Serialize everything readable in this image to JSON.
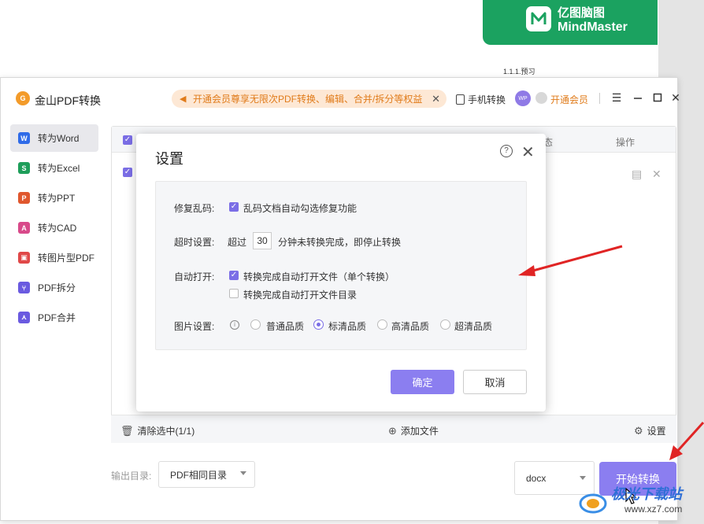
{
  "background": {
    "banner": {
      "brand_cn": "亿图脑图",
      "brand_en": "MindMaster"
    },
    "doc_text": "1.1.1.预习"
  },
  "app": {
    "title": "金山PDF转换",
    "promo_text": "开通会员尊享无限次PDF转换、编辑、合并/拆分等权益",
    "mobile_convert": "手机转换",
    "avatar_text": "WP",
    "vip_label": "开通会员",
    "accent": "#8b7ef0"
  },
  "sidebar": {
    "items": [
      {
        "label": "转为Word",
        "icon": "W",
        "color": "#2f6be8",
        "active": true
      },
      {
        "label": "转为Excel",
        "icon": "S",
        "color": "#1e9e5a",
        "active": false
      },
      {
        "label": "转为PPT",
        "icon": "P",
        "color": "#e0572e",
        "active": false
      },
      {
        "label": "转为CAD",
        "icon": "A",
        "color": "#d84a8a",
        "active": false
      },
      {
        "label": "转图片型PDF",
        "icon": "img",
        "color": "#e04848",
        "active": false
      },
      {
        "label": "PDF拆分",
        "icon": "split",
        "color": "#6a5ae0",
        "active": false
      },
      {
        "label": "PDF合并",
        "icon": "merge",
        "color": "#6a5ae0",
        "active": false
      }
    ]
  },
  "table": {
    "header_status": "态",
    "header_action": "操作"
  },
  "bottombar": {
    "clear_label": "清除选中(1/1)",
    "add_label": "添加文件",
    "settings_label": "设置"
  },
  "footer": {
    "output_label": "输出目录:",
    "output_value": "PDF相同目录",
    "format_value": "docx",
    "start_label": "开始转换"
  },
  "dialog": {
    "title": "设置",
    "repair_label": "修复乱码:",
    "repair_option": "乱码文档自动勾选修复功能",
    "timeout_label": "超时设置:",
    "timeout_prefix": "超过",
    "timeout_value": "30",
    "timeout_suffix": "分钟未转换完成，即停止转换",
    "autoopen_label": "自动打开:",
    "autoopen_file": "转换完成自动打开文件（单个转换）",
    "autoopen_dir": "转换完成自动打开文件目录",
    "image_label": "图片设置:",
    "quality_options": [
      "普通品质",
      "标清品质",
      "高清品质",
      "超清品质"
    ],
    "quality_selected": "标清品质",
    "ok_label": "确定",
    "cancel_label": "取消"
  },
  "watermark": {
    "text": "极光下载站",
    "url": "www.xz7.com"
  }
}
